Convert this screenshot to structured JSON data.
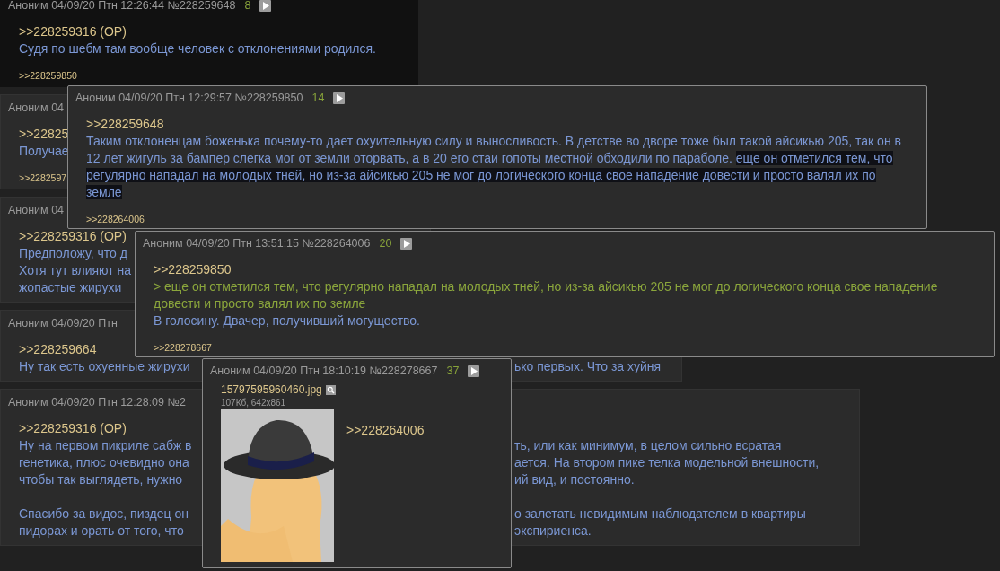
{
  "posts": [
    {
      "header": "Аноним 04/09/20 Птн 12:26:44 №228259648",
      "count": "8",
      "highlighted": true,
      "reply": ">>228259316 (OP)",
      "lines": [
        [
          "Судя по шебм там вообще человек с отклонениями родился."
        ]
      ],
      "backlink": ">>228259850"
    },
    {
      "header": "Аноним 04",
      "highlighted": false,
      "reply": ">>22825",
      "lines": [
        [
          "Получае"
        ]
      ],
      "backlink": ">>2282597"
    },
    {
      "header": "Аноним 04",
      "highlighted": false,
      "reply": ">>228259316 (OP)",
      "lines": [
        [
          "Предположу, что д"
        ],
        [
          "Хотя тут влияют на"
        ],
        [
          "жопастые жирухи"
        ]
      ]
    },
    {
      "header": "Аноним 04/09/20 Птн",
      "highlighted": false,
      "reply": ">>228259664",
      "lines": [
        [
          "Ну так есть охуенные жирухи",
          "ько первых. Что за хуйня"
        ]
      ]
    },
    {
      "header": "Аноним 04/09/20 Птн 12:28:09 №2",
      "highlighted": false,
      "reply": ">>228259316 (OP)",
      "lines": [
        [
          "Ну на первом пикриле сабж в",
          "ть, или как минимум, в целом сильно всратая"
        ],
        [
          "генетика, плюс очевидно она",
          "ается. На втором пике телка модельной внешности,"
        ],
        [
          "чтобы так выглядеть, нужно",
          "ий вид, и постоянно."
        ]
      ],
      "lines_after_break": [
        [
          "Спасибо за видос, пиздец он",
          "о залетать невидимым наблюдателем в квартиры"
        ],
        [
          "пидорах и орать от того, что",
          "экспириенса."
        ]
      ]
    }
  ],
  "popups": [
    {
      "header": "Аноним 04/09/20 Птн 12:29:57 №228259850",
      "count": "14",
      "reply": ">>228259648",
      "paragraphs": [
        {
          "kind": "plain",
          "segments": [
            {
              "text": "Таким отклоненцам боженька почему-то дает охуительную силу и выносливость. В детстве во дворе тоже был такой айсикью 205, так он в 12 лет жигуль за бампер слегка мог от земли оторвать, а в 20 его стаи гопоты местной обходили по параболе. ",
              "selected": false
            },
            {
              "text": "еще он отметился тем, что регулярно нападал на молодых тней, но из-за айсикью 205 не мог до логического конца свое нападение довести и просто валял их по земле",
              "selected": true
            }
          ]
        }
      ],
      "backlink": ">>228264006"
    },
    {
      "header": "Аноним 04/09/20 Птн 13:51:15 №228264006",
      "count": "20",
      "reply": ">>228259850",
      "paragraphs": [
        {
          "kind": "quote",
          "segments": [
            {
              "text": "> еще он отметился тем, что регулярно нападал на молодых тней, но из-за айсикью 205 не мог до логического конца свое нападение довести и просто валял их по земле",
              "selected": false
            }
          ]
        },
        {
          "kind": "plain",
          "segments": [
            {
              "text": "В голосину. Двачер, получивший могущество.",
              "selected": false
            }
          ]
        }
      ],
      "backlink": ">>228278667"
    },
    {
      "header": "Аноним 04/09/20 Птн 18:10:19 №228278667",
      "count": "37",
      "file": {
        "name": "15797595960460.jpg",
        "meta": "107Кб, 642x861",
        "kind": "picture"
      },
      "reply": ">>228264006"
    }
  ]
}
